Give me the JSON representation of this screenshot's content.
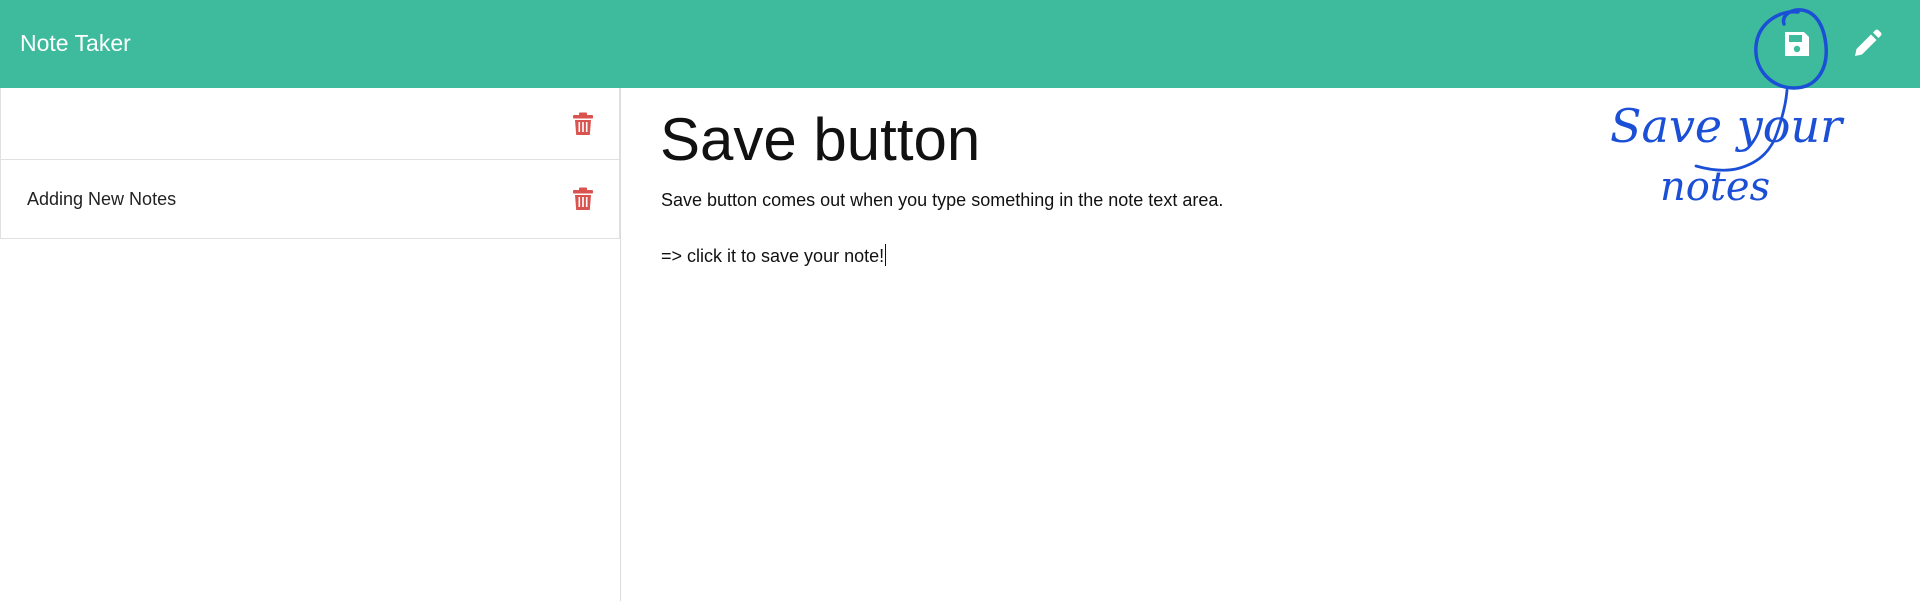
{
  "app": {
    "title": "Note Taker"
  },
  "theme": {
    "accent": "#3dbb9c",
    "delete_color": "#d9534f",
    "annotation_color": "#1a4fd6"
  },
  "toolbar": {
    "save_icon": "save-icon",
    "new_note_icon": "pencil-icon"
  },
  "notes_list": [
    {
      "title": "",
      "delete_icon": "trash-icon"
    },
    {
      "title": "Adding New Notes",
      "delete_icon": "trash-icon"
    }
  ],
  "editor": {
    "title": "Save button",
    "body_lines": [
      "Save button comes out when you type something in the note text area.",
      "",
      "=> click it to save your note!"
    ]
  },
  "annotation": {
    "line1": "Save your",
    "line2": "notes"
  }
}
